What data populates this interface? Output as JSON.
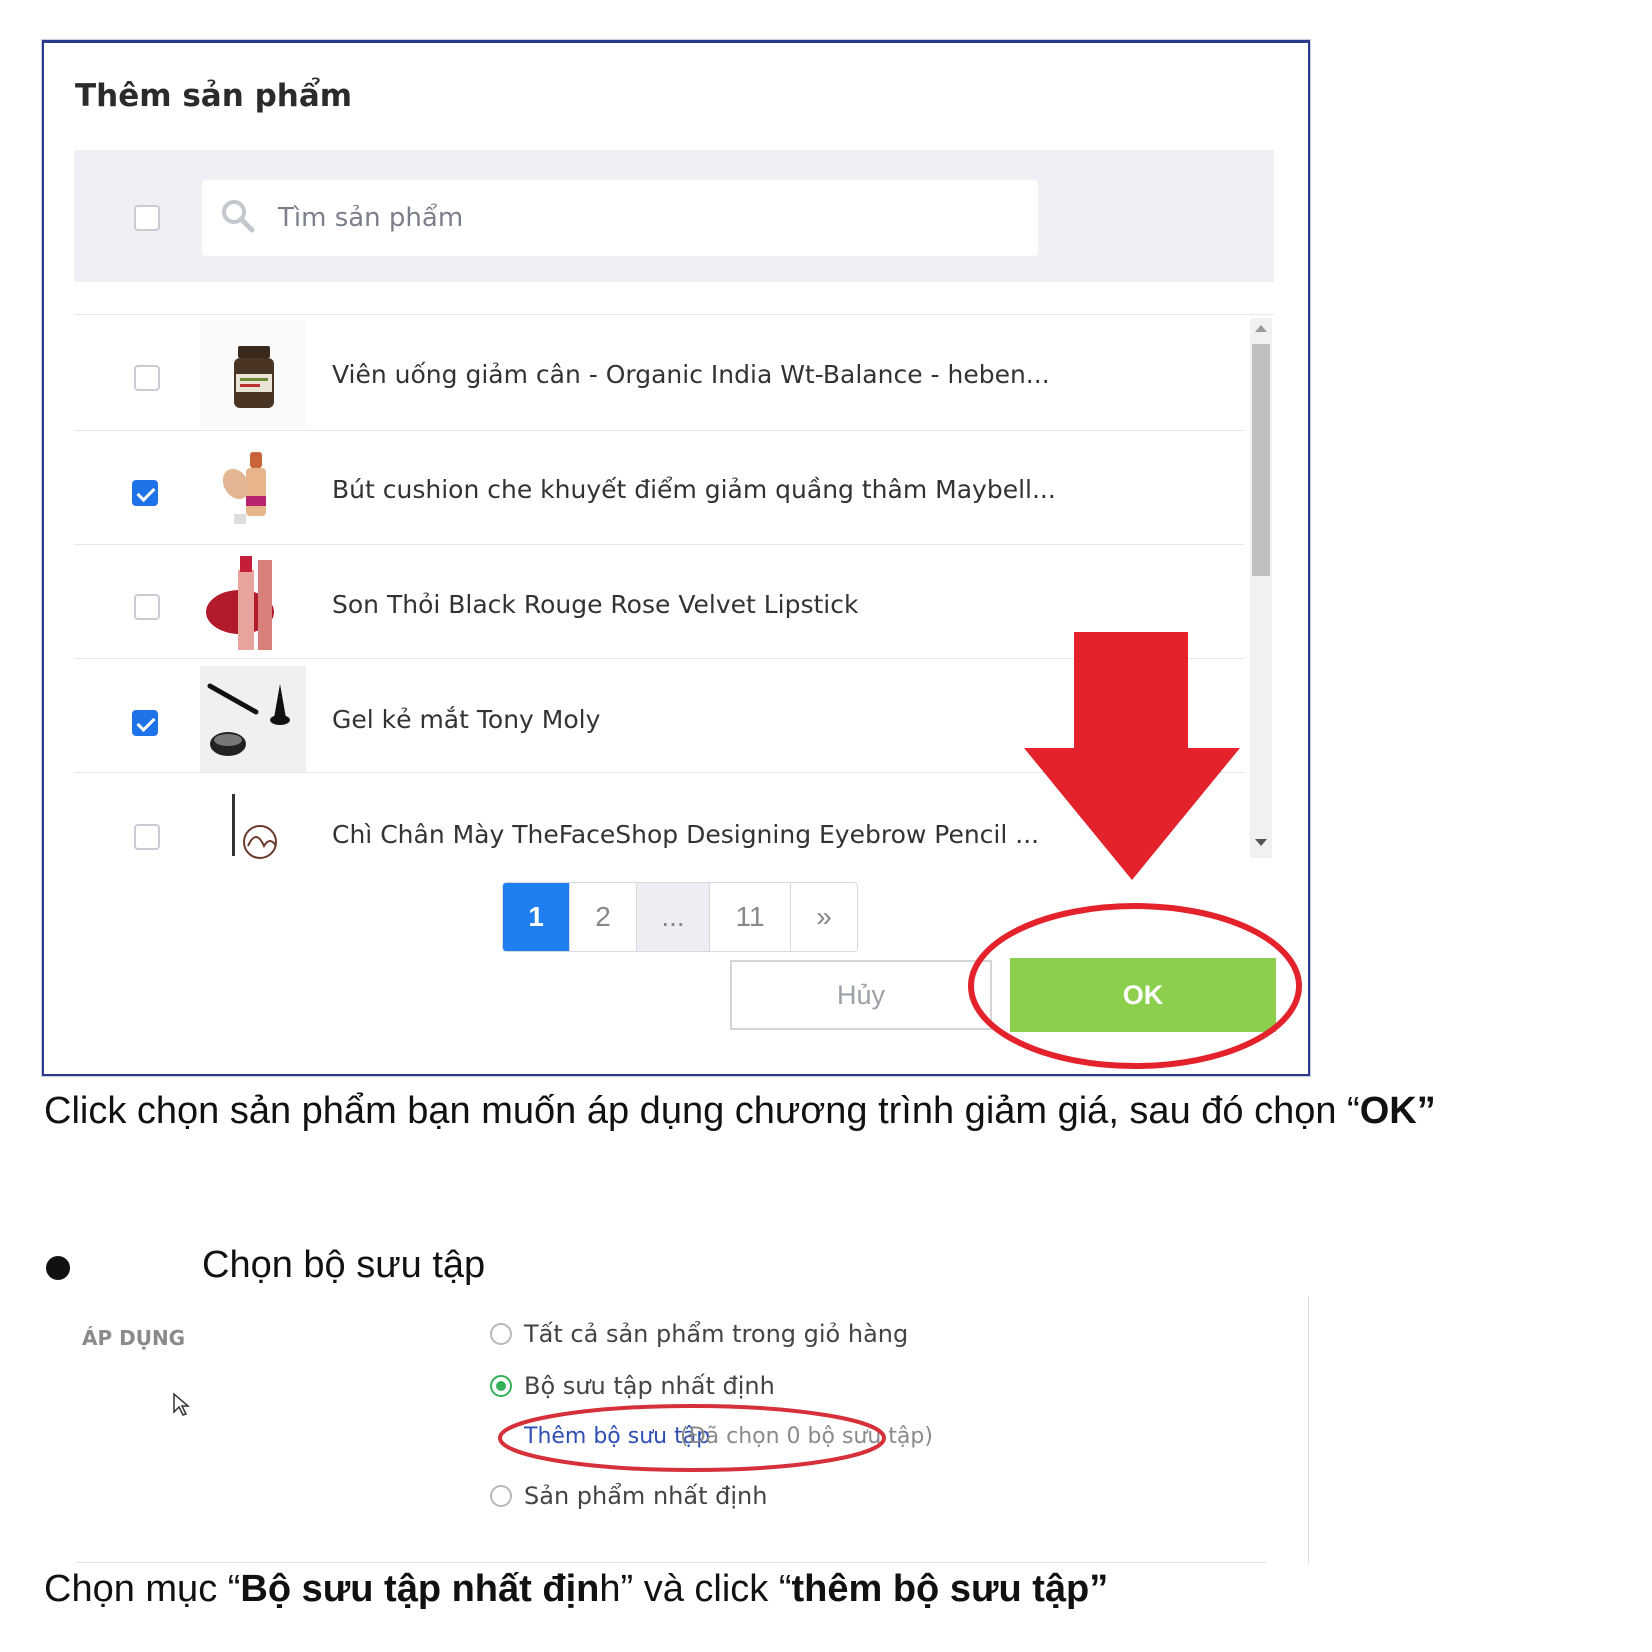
{
  "modal": {
    "title": "Thêm sản phẩm",
    "search_placeholder": "Tìm sản phẩm",
    "products": [
      {
        "name": "Viên uống giảm cân - Organic India Wt-Balance - heben...",
        "checked": false
      },
      {
        "name": "Bút cushion che khuyết điểm giảm quầng thâm Maybell...",
        "checked": true
      },
      {
        "name": "Son Thỏi Black Rouge Rose Velvet Lipstick",
        "checked": false
      },
      {
        "name": "Gel kẻ mắt Tony Moly",
        "checked": true
      },
      {
        "name": "Chì Chân Mày TheFaceShop Designing Eyebrow Pencil ...",
        "checked": false
      }
    ],
    "pagination": {
      "p1": "1",
      "p2": "2",
      "ellipsis": "...",
      "last": "11",
      "next": "»"
    },
    "cancel_label": "Hủy",
    "ok_label": "OK"
  },
  "caption1": {
    "before": "Click chọn sản phẩm bạn muốn áp dụng chương trình giảm giá, sau đó chọn “",
    "bold": "OK",
    "after": "”"
  },
  "bullet_heading": "Chọn bộ sưu tập",
  "apply_section": {
    "label": "ÁP DỤNG",
    "options": [
      {
        "label": "Tất cả sản phẩm trong giỏ hàng",
        "selected": false
      },
      {
        "label": "Bộ sưu tập nhất định",
        "selected": true
      },
      {
        "label": "Sản phẩm nhất định",
        "selected": false
      }
    ],
    "add_collection_link": "Thêm bộ sưu tập",
    "selected_note": "(Đã chọn 0 bộ sưu tập)"
  },
  "caption2": {
    "p1": "Chọn mục “",
    "b1": "Bộ sưu tập nhất địn",
    "p2": "h” và click “",
    "b2": "thêm bộ sưu tập”"
  },
  "colors": {
    "primary_blue": "#1f7ff0",
    "ok_green": "#8ccf4d",
    "annotation_red": "#e3222b",
    "modal_border": "#2b3a8f",
    "radio_green": "#35b15a"
  }
}
